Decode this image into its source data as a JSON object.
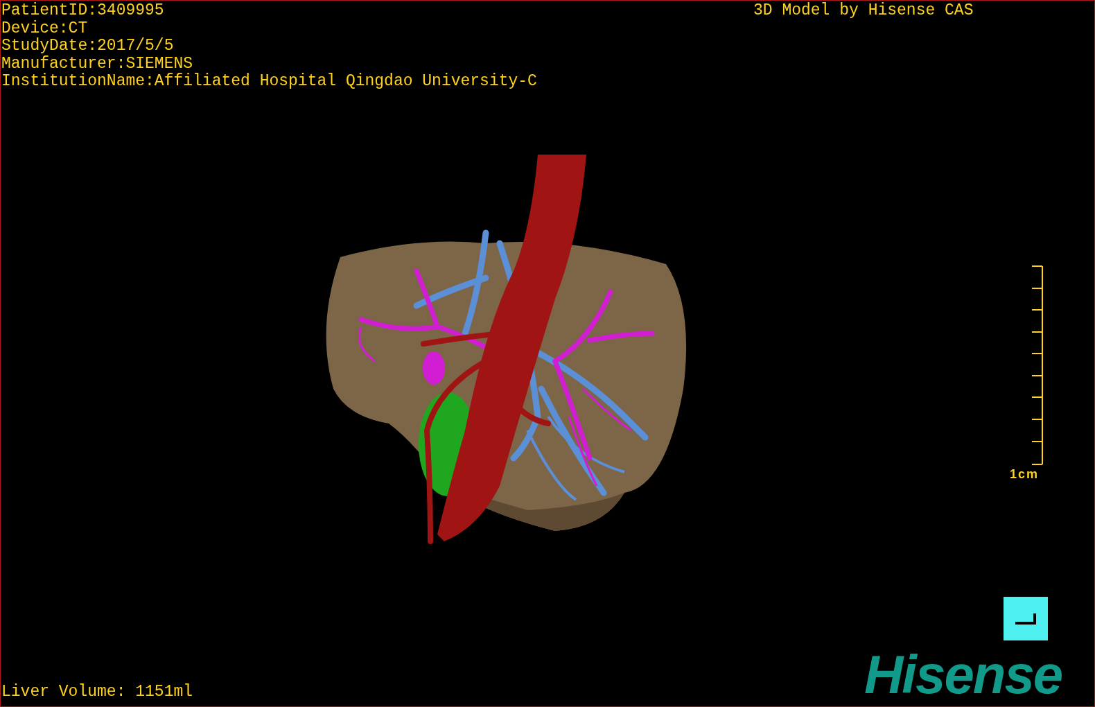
{
  "study_info": [
    "PatientID:3409995",
    "Device:CT",
    "StudyDate:2017/5/5",
    "Manufacturer:SIEMENS",
    "InstitutionName:Affiliated Hospital Qingdao University-C"
  ],
  "model_credit": "3D Model by Hisense CAS",
  "scale_bar": {
    "label": "1cm"
  },
  "logo": "Hisense",
  "liver_volume": "Liver Volume: 1151ml"
}
